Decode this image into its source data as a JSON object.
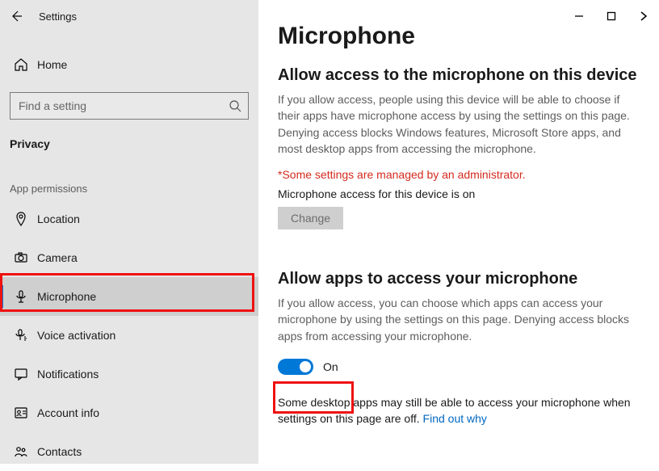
{
  "window": {
    "title": "Settings"
  },
  "sidebar": {
    "home_label": "Home",
    "search_placeholder": "Find a setting",
    "section_label": "Privacy",
    "group_header": "App permissions",
    "items": [
      {
        "label": "Location"
      },
      {
        "label": "Camera"
      },
      {
        "label": "Microphone"
      },
      {
        "label": "Voice activation"
      },
      {
        "label": "Notifications"
      },
      {
        "label": "Account info"
      },
      {
        "label": "Contacts"
      }
    ]
  },
  "main": {
    "page_title": "Microphone",
    "section1": {
      "heading": "Allow access to the microphone on this device",
      "desc": "If you allow access, people using this device will be able to choose if their apps have microphone access by using the settings on this page. Denying access blocks Windows features, Microsoft Store apps, and most desktop apps from accessing the microphone.",
      "admin_note": "*Some settings are managed by an administrator.",
      "status_line": "Microphone access for this device is on",
      "change_label": "Change"
    },
    "section2": {
      "heading": "Allow apps to access your microphone",
      "desc": "If you allow access, you can choose which apps can access your microphone by using the settings on this page. Denying access blocks apps from accessing your microphone.",
      "toggle_state": "On",
      "note_prefix": "Some desktop apps may still be able to access your microphone when settings on this page are off. ",
      "note_link": "Find out why"
    }
  }
}
